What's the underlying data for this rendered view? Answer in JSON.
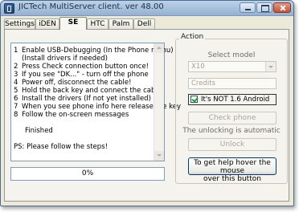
{
  "window": {
    "title": "JICTech MultiServer client. ver 48.00"
  },
  "tabs": [
    {
      "label": "Settings"
    },
    {
      "label": "iDEN"
    },
    {
      "label": "SE"
    },
    {
      "label": "HTC"
    },
    {
      "label": "Palm"
    },
    {
      "label": "Dell"
    }
  ],
  "active_tab": "SE",
  "instructions": {
    "lines": [
      {
        "num": "1",
        "text": "Enable USB-Debugging (In the Phone menu)"
      },
      {
        "num": "",
        "text": "(Install drivers if needed)"
      },
      {
        "num": "2",
        "text": "Press Check connection button once!"
      },
      {
        "num": "3",
        "text": "If you see \"DK...\" - turn off the phone"
      },
      {
        "num": "4",
        "text": "Power off, disconnect the cable!"
      },
      {
        "num": "5",
        "text": "Hold the back key and connect the cable"
      },
      {
        "num": "6",
        "text": "Install the drivers (If not yet installed)"
      },
      {
        "num": "7",
        "text": "When you see phone info here release the key"
      },
      {
        "num": "8",
        "text": "Follow the on-screen messages"
      }
    ],
    "finished": "Finished",
    "ps": "PS: Please follow the steps!"
  },
  "progress": {
    "label": "0%",
    "value": 0
  },
  "action": {
    "group_label": "Action",
    "select_model_label": "Select model",
    "model_value": "X10",
    "credits_placeholder": "Credits",
    "android_check_label": "It's NOT 1.6 Android",
    "android_checked": true,
    "check_phone_label": "Check phone",
    "unlock_status": "The unlocking is automatic",
    "unlock_label": "Unlock",
    "help_line1": "To get help hover the mouse",
    "help_line2": "over this button"
  }
}
